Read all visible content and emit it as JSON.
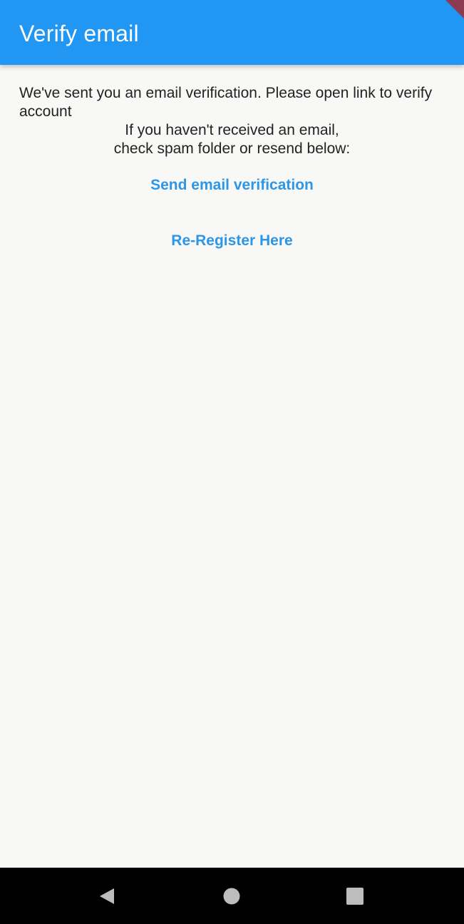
{
  "app_bar": {
    "title": "Verify email",
    "color": "#2196f3"
  },
  "message": {
    "sent": "We've sent you an email verification. Please open link to verify account",
    "hint_line1": "If you haven't received an email,",
    "hint_line2": "check spam folder or resend below:"
  },
  "actions": {
    "send_verification_label": "Send email verification",
    "reregister_label": "Re-Register Here",
    "link_color": "#2e96e4"
  },
  "nav_bar": {
    "icons": [
      "back-icon",
      "home-icon",
      "recents-icon"
    ]
  }
}
